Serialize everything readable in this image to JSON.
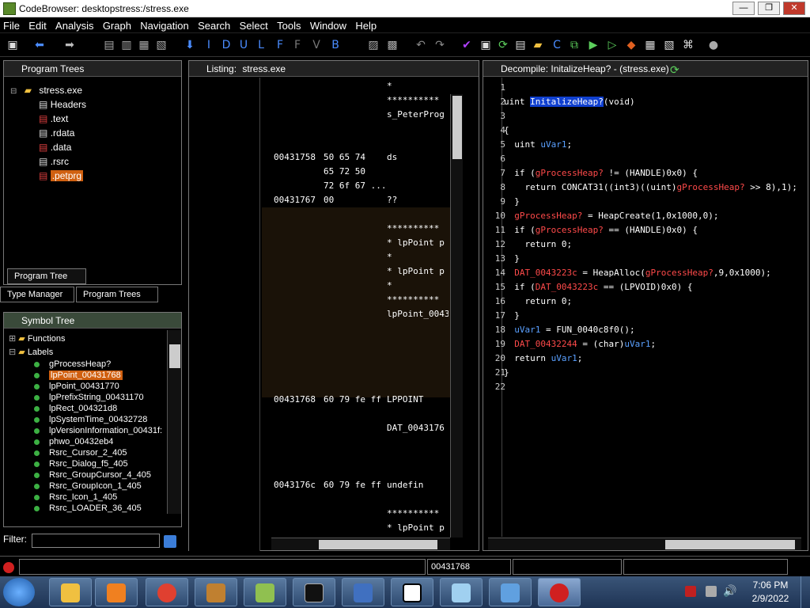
{
  "window": {
    "title": "CodeBrowser: desktopstress:/stress.exe",
    "min": "—",
    "max": "❐",
    "close": "✕"
  },
  "menu": [
    "File",
    "Edit",
    "Analysis",
    "Graph",
    "Navigation",
    "Search",
    "Select",
    "Tools",
    "Window",
    "Help"
  ],
  "program_trees": {
    "title": "Program Trees",
    "root": "stress.exe",
    "items": [
      "Headers",
      ".text",
      ".rdata",
      ".data",
      ".rsrc",
      ".petprg"
    ],
    "tab_active": "Program Tree"
  },
  "bottom_tabs": [
    "Type Manager",
    "Program Trees"
  ],
  "symbol_tree": {
    "title": "Symbol Tree",
    "folders": [
      "Functions",
      "Labels"
    ],
    "labels": [
      "gProcessHeap?",
      "lpPoint_00431768",
      "lpPoint_00431770",
      "lpPrefixString_00431170",
      "lpRect_004321d8",
      "lpSystemTime_00432728",
      "lpVersionInformation_00431f:",
      "phwo_00432eb4",
      "Rsrc_Cursor_2_405",
      "Rsrc_Dialog_f5_405",
      "Rsrc_GroupCursor_4_405",
      "Rsrc_GroupIcon_1_405",
      "Rsrc_Icon_1_405",
      "Rsrc_LOADER_36_405"
    ],
    "filter_label": "Filter:"
  },
  "listing": {
    "title": "Listing:",
    "file": "stress.exe",
    "rows": [
      {
        "addr": "",
        "bytes": "",
        "mn": "*"
      },
      {
        "addr": "",
        "bytes": "",
        "mn": "**********"
      },
      {
        "addr": "",
        "bytes": "",
        "mn": "s_PeterProg"
      },
      {
        "addr": "00431758",
        "bytes": "50 65 74",
        "mn": "ds"
      },
      {
        "addr": "",
        "bytes": "65 72 50",
        "mn": ""
      },
      {
        "addr": "",
        "bytes": "72 6f 67 ...",
        "mn": ""
      },
      {
        "addr": "00431767",
        "bytes": "00",
        "mn": "??"
      },
      {
        "addr": "",
        "bytes": "",
        "mn": "**********"
      },
      {
        "addr": "",
        "bytes": "",
        "mn": "* lpPoint p"
      },
      {
        "addr": "",
        "bytes": "",
        "mn": "*"
      },
      {
        "addr": "",
        "bytes": "",
        "mn": "* lpPoint p"
      },
      {
        "addr": "",
        "bytes": "",
        "mn": "*"
      },
      {
        "addr": "",
        "bytes": "",
        "mn": "**********"
      },
      {
        "addr": "",
        "bytes": "",
        "mn": "lpPoint_0043"
      },
      {
        "addr": "00431768",
        "bytes": "60 79 fe ff",
        "mn": "LPPOINT"
      },
      {
        "addr": "",
        "bytes": "",
        "mn": "DAT_0043176"
      },
      {
        "addr": "0043176c",
        "bytes": "60 79 fe ff",
        "mn": "undefin"
      },
      {
        "addr": "",
        "bytes": "",
        "mn": "**********"
      },
      {
        "addr": "",
        "bytes": "",
        "mn": "* lpPoint p"
      }
    ]
  },
  "decompile": {
    "title": "Decompile: InitalizeHeap? -  (stress.exe)",
    "lines": [
      "",
      "uint InitalizeHeap?(void)",
      "",
      "{",
      "  uint uVar1;",
      "",
      "  if (gProcessHeap? != (HANDLE)0x0) {",
      "    return CONCAT31((int3)((uint)gProcessHeap? >> 8),1);",
      "  }",
      "  gProcessHeap? = HeapCreate(1,0x1000,0);",
      "  if (gProcessHeap? == (HANDLE)0x0) {",
      "    return 0;",
      "  }",
      "  DAT_0043223c = HeapAlloc(gProcessHeap?,9,0x1000);",
      "  if (DAT_0043223c == (LPVOID)0x0) {",
      "    return 0;",
      "  }",
      "  uVar1 = FUN_0040c8f0();",
      "  DAT_00432244 = (char)uVar1;",
      "  return uVar1;",
      "}",
      ""
    ]
  },
  "status": {
    "address": "00431768"
  },
  "clock": {
    "time": "7:06 PM",
    "date": "2/9/2022"
  }
}
